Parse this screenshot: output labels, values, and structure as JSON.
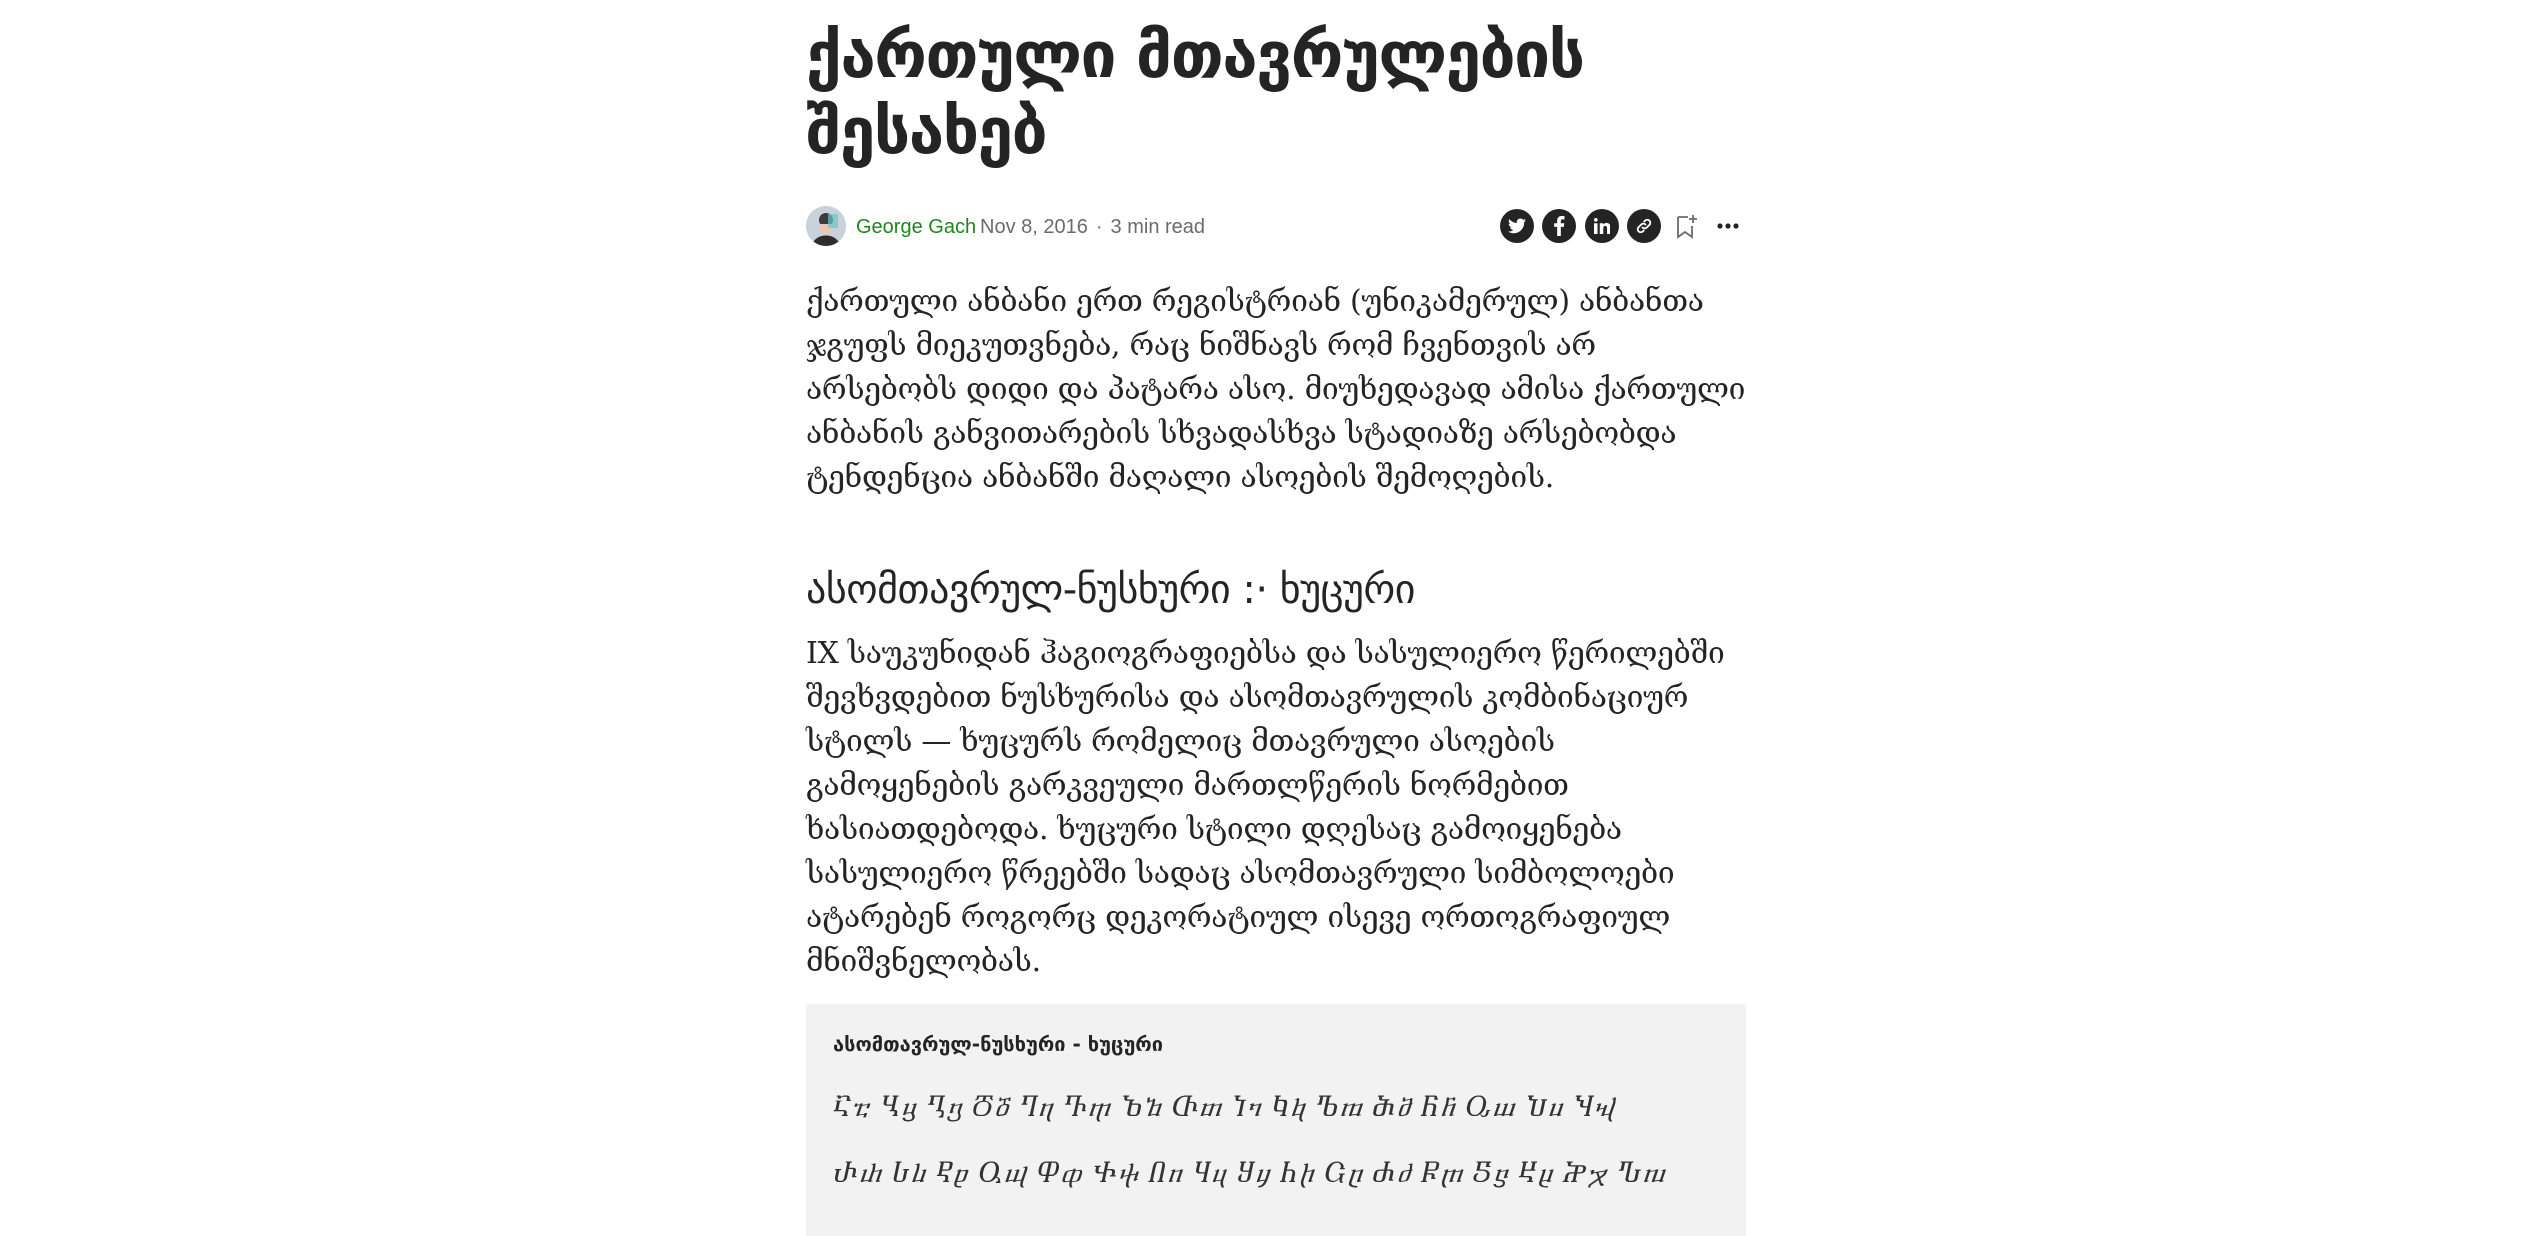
{
  "article": {
    "title": "ქართული მთავრულების შესახებ",
    "author": "George Gach",
    "date": "Nov 8, 2016",
    "separator": "·",
    "read_time": "3 min read",
    "paragraph_1": "ქართული ანბანი ერთ რეგისტრიან (უნიკამერულ) ანბანთა ჯგუფს მიეკუთვნება, რაც ნიშნავს რომ ჩვენთვის არ არსებობს დიდი და პატარა ასო. მიუხედავად ამისა ქართული ანბანის განვითარების სხვადასხვა სტადიაზე არსებობდა ტენდენცია ანბანში მაღალი ასოების შემოღების.",
    "heading_1": "ასომთავრულ-ნუსხური :· ხუცური",
    "paragraph_2": "IX საუკუნიდან ჰაგიოგრაფიებსა და სასულიერო წერილებში შევხვდებით ნუსხურისა და ასომთავრულის კომბინაციურ სტილს — ხუცურს რომელიც მთავრული ასოების გამოყენების გარკვეული მართლწერის ნორმებით ხასიათდებოდა. ხუცური სტილი დღესაც გამოიყენება სასულიერო წრეებში სადაც ასომთავრული სიმბოლოები ატარებენ როგორც დეკორატიულ ისევე ორთოგრაფიულ მნიშვნელობას.",
    "figure": {
      "title": "ასომთავრულ-ნუსხური  -  ხუცური",
      "row_1": "Ⴀⴀ Ⴁⴁ Ⴂⴂ Ⴃⴃ Ⴄⴄ Ⴅⴅ Ⴆⴆ Ⴇⴇ Ⴈⴈ Ⴉⴉ Ⴊⴊ Ⴋⴋ Ⴌⴌ Ⴍⴍ Ⴎⴎ Ⴏⴏ",
      "row_2": "Ⴐⴐ Ⴑⴑ Ⴒⴒ Ⴓⴓ Ⴔⴔ Ⴕⴕ Ⴖⴖ Ⴗⴗ Ⴘⴘ Ⴙⴙ Ⴚⴚ Ⴛⴛ Ⴜⴜ Ⴝⴝ Ⴞⴞ Ⴟⴟ Ⴠⴠ"
    }
  },
  "icons": {
    "twitter": "twitter-icon",
    "facebook": "facebook-icon",
    "linkedin": "linkedin-icon",
    "copy_link": "link-icon",
    "bookmark": "bookmark-add-icon",
    "more": "more-icon"
  },
  "colors": {
    "author": "#1a8917",
    "text": "#242424",
    "meta": "#6b6b6b",
    "figure_bg": "#f2f2f2"
  }
}
